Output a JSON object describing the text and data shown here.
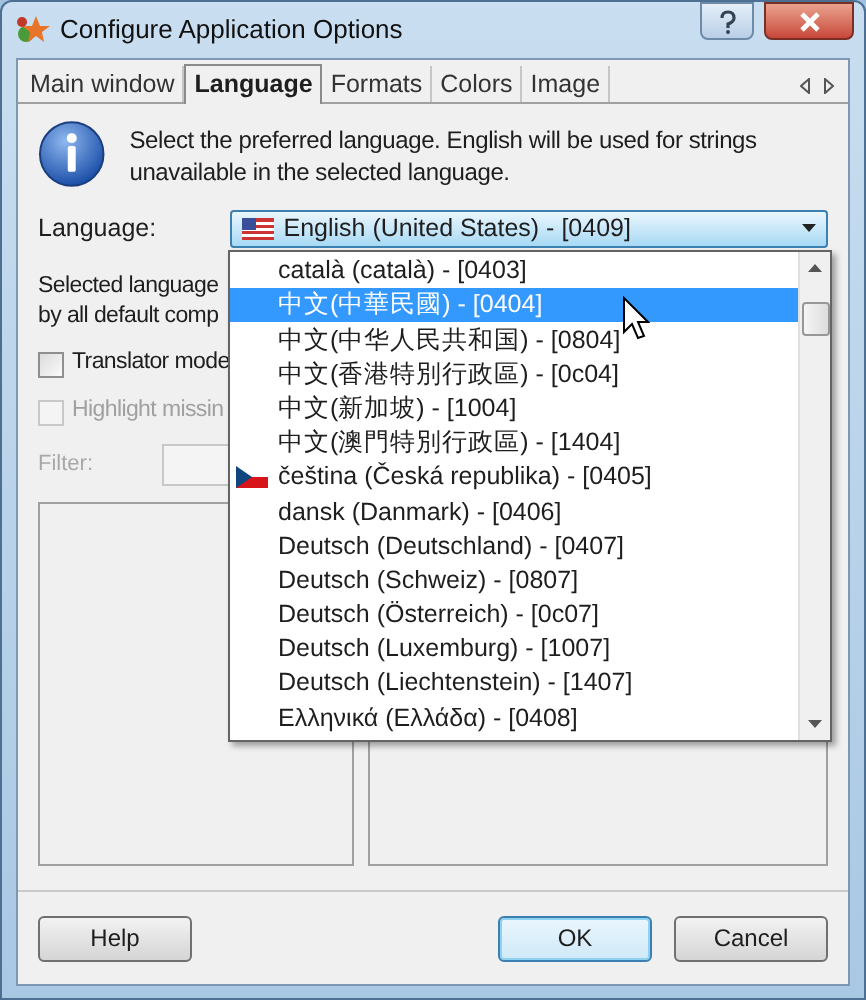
{
  "window": {
    "title": "Configure Application Options"
  },
  "tabs": [
    {
      "label": "Main window",
      "selected": false
    },
    {
      "label": "Language",
      "selected": true
    },
    {
      "label": "Formats",
      "selected": false
    },
    {
      "label": "Colors",
      "selected": false
    },
    {
      "label": "Image",
      "selected": false
    }
  ],
  "info": {
    "text": "Select the preferred language. English will be used for strings unavailable in the selected language."
  },
  "language": {
    "label": "Language:",
    "value": "English (United States) - [0409]",
    "expanded": true,
    "options": [
      {
        "label": "català (català) - [0403]",
        "selected": false,
        "kind": "plain"
      },
      {
        "label": "中文(中華民國) - [0404]",
        "selected": true,
        "kind": "plain"
      },
      {
        "label": "中文(中华人民共和国) - [0804]",
        "selected": false,
        "kind": "plain"
      },
      {
        "label": "中文(香港特別行政區) - [0c04]",
        "selected": false,
        "kind": "plain"
      },
      {
        "label": "中文(新加坡) - [1004]",
        "selected": false,
        "kind": "plain"
      },
      {
        "label": "中文(澳門特別行政區) - [1404]",
        "selected": false,
        "kind": "plain"
      },
      {
        "label": "čeština (Česká republika) - [0405]",
        "selected": false,
        "kind": "flagged"
      },
      {
        "label": "dansk (Danmark) - [0406]",
        "selected": false,
        "kind": "plain"
      },
      {
        "label": "Deutsch (Deutschland) - [0407]",
        "selected": false,
        "kind": "plain"
      },
      {
        "label": "Deutsch (Schweiz) - [0807]",
        "selected": false,
        "kind": "plain"
      },
      {
        "label": "Deutsch (Österreich) - [0c07]",
        "selected": false,
        "kind": "plain"
      },
      {
        "label": "Deutsch (Luxemburg) - [1007]",
        "selected": false,
        "kind": "plain"
      },
      {
        "label": "Deutsch (Liechtenstein) - [1407]",
        "selected": false,
        "kind": "plain"
      },
      {
        "label": "Ελληνικά (Ελλάδα) - [0408]",
        "selected": false,
        "kind": "plain"
      }
    ]
  },
  "note_lines": [
    "Selected language",
    "by all default comp"
  ],
  "options": [
    {
      "label": "Translator mode",
      "checked": false,
      "disabled": false
    },
    {
      "label": "Highlight missin",
      "checked": false,
      "disabled": true
    }
  ],
  "filter": {
    "label": "Filter:",
    "disabled": true
  },
  "buttons": [
    {
      "label": "Help",
      "default": false
    },
    {
      "label": "OK",
      "default": true
    },
    {
      "label": "Cancel",
      "default": false
    }
  ]
}
